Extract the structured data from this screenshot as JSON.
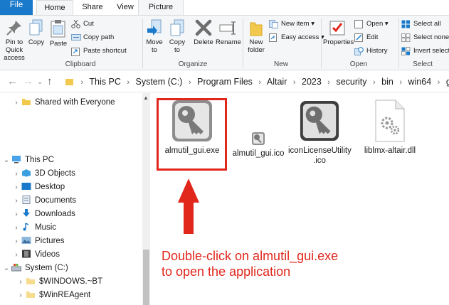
{
  "ribbon_tabs": {
    "file": "File",
    "home": "Home",
    "share": "Share",
    "view": "View",
    "picture_tools": "Picture Tools"
  },
  "clipboard": {
    "pin": "Pin to Quick\naccess",
    "copy": "Copy",
    "paste": "Paste",
    "cut": "Cut",
    "copy_path": "Copy path",
    "paste_shortcut": "Paste shortcut",
    "label": "Clipboard"
  },
  "organize": {
    "move_to": "Move\nto",
    "copy_to": "Copy\nto",
    "delete": "Delete",
    "rename": "Rename",
    "label": "Organize"
  },
  "new": {
    "new_folder": "New\nfolder",
    "new_item": "New item",
    "easy_access": "Easy access",
    "label": "New"
  },
  "open": {
    "properties": "Properties",
    "open": "Open",
    "edit": "Edit",
    "history": "History",
    "label": "Open"
  },
  "select": {
    "select_all": "Select all",
    "select_none": "Select none",
    "invert_selection": "Invert selection",
    "label": "Select"
  },
  "breadcrumb": [
    "This PC",
    "System (C:)",
    "Program Files",
    "Altair",
    "2023",
    "security",
    "bin",
    "win64",
    "gui"
  ],
  "nav_tree": [
    {
      "label": "Shared with Everyone",
      "arrow": "›",
      "icon": "folder-icon"
    },
    {
      "label": "This PC",
      "arrow": "⌄",
      "icon": "computer-icon"
    },
    {
      "label": "3D Objects",
      "arrow": "›",
      "icon": "3d-objects-icon"
    },
    {
      "label": "Desktop",
      "arrow": "›",
      "icon": "desktop-icon"
    },
    {
      "label": "Documents",
      "arrow": "›",
      "icon": "documents-icon"
    },
    {
      "label": "Downloads",
      "arrow": "›",
      "icon": "downloads-icon"
    },
    {
      "label": "Music",
      "arrow": "›",
      "icon": "music-icon"
    },
    {
      "label": "Pictures",
      "arrow": "›",
      "icon": "pictures-icon"
    },
    {
      "label": "Videos",
      "arrow": "›",
      "icon": "videos-icon"
    },
    {
      "label": "System (C:)",
      "arrow": "⌄",
      "icon": "drive-icon"
    },
    {
      "label": "$WINDOWS.~BT",
      "arrow": "›",
      "icon": "folder-icon"
    },
    {
      "label": "$WinREAgent",
      "arrow": "›",
      "icon": "folder-icon"
    }
  ],
  "files": [
    {
      "name": "almutil_gui.exe",
      "icon": "key-icon"
    },
    {
      "name": "almutil_gui.ico",
      "icon": "key-icon"
    },
    {
      "name": "iconLicenseUtility\n.ico",
      "icon": "key-icon"
    },
    {
      "name": "liblmx-altair.dll",
      "icon": "dll-file-icon"
    }
  ],
  "annotation": {
    "line1": "Double-click on almutil_gui.exe",
    "line2": "to open the application",
    "color": "#e1261c"
  },
  "colors": {
    "accent": "#1979ca",
    "ribbon_bg": "#f5f6f7",
    "folder": "#f2c94c"
  }
}
